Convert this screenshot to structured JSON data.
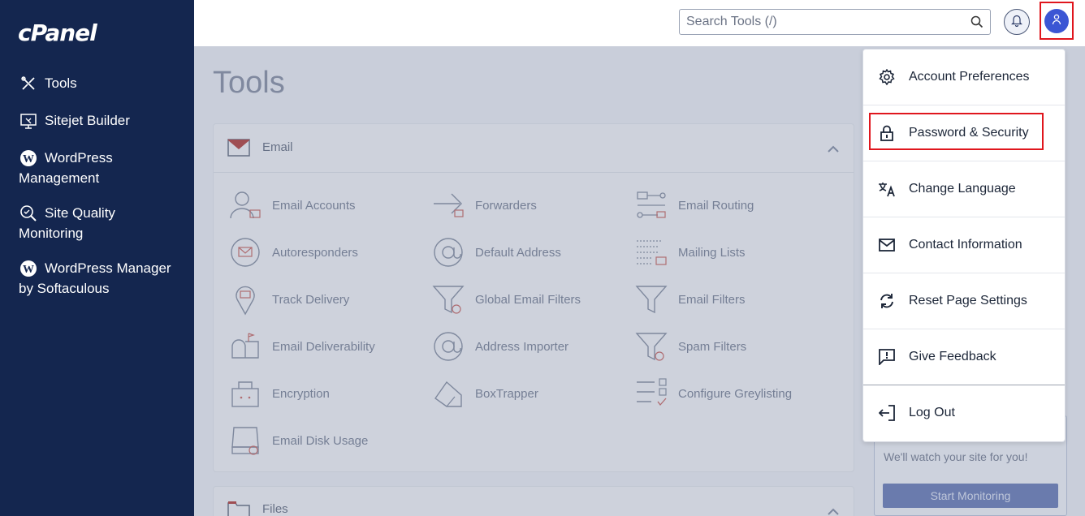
{
  "brand": {
    "logo_text": "cPanel"
  },
  "sidebar": {
    "items": [
      {
        "label": "Tools",
        "icon": "tools-icon"
      },
      {
        "label": "Sitejet Builder",
        "icon": "sitejet-icon"
      },
      {
        "label": "WordPress",
        "label2": "Management",
        "icon": "wordpress-icon"
      },
      {
        "label": "Site Quality",
        "label2": "Monitoring",
        "icon": "site-quality-icon"
      },
      {
        "label": "WordPress Manager",
        "label2": "by Softaculous",
        "icon": "wordpress-icon"
      }
    ]
  },
  "header": {
    "search_placeholder": "Search Tools (/)",
    "bell_icon": "bell-icon",
    "user_icon": "user-icon"
  },
  "main": {
    "title": "Tools",
    "email_section": {
      "title": "Email",
      "tools": [
        {
          "label": "Email Accounts",
          "icon": "email-accounts-icon"
        },
        {
          "label": "Forwarders",
          "icon": "forwarders-icon"
        },
        {
          "label": "Email Routing",
          "icon": "email-routing-icon"
        },
        {
          "label": "Autoresponders",
          "icon": "autoresponders-icon"
        },
        {
          "label": "Default Address",
          "icon": "default-address-icon"
        },
        {
          "label": "Mailing Lists",
          "icon": "mailing-lists-icon"
        },
        {
          "label": "Track Delivery",
          "icon": "track-delivery-icon"
        },
        {
          "label": "Global Email Filters",
          "icon": "global-email-filters-icon"
        },
        {
          "label": "Email Filters",
          "icon": "email-filters-icon"
        },
        {
          "label": "Email Deliverability",
          "icon": "email-deliverability-icon"
        },
        {
          "label": "Address Importer",
          "icon": "address-importer-icon"
        },
        {
          "label": "Spam Filters",
          "icon": "spam-filters-icon"
        },
        {
          "label": "Encryption",
          "icon": "encryption-icon"
        },
        {
          "label": "BoxTrapper",
          "icon": "boxtrapper-icon"
        },
        {
          "label": "Configure Greylisting",
          "icon": "greylisting-icon"
        },
        {
          "label": "Email Disk Usage",
          "icon": "email-disk-usage-icon"
        }
      ]
    },
    "files_section": {
      "title": "Files"
    },
    "monitor_widget": {
      "text": "We'll watch your site for you!",
      "button": "Start Monitoring"
    }
  },
  "user_menu": {
    "items": [
      {
        "label": "Account Preferences",
        "icon": "gear-icon"
      },
      {
        "label": "Password & Security",
        "icon": "lock-icon"
      },
      {
        "label": "Change Language",
        "icon": "translate-icon"
      },
      {
        "label": "Contact Information",
        "icon": "mail-icon"
      },
      {
        "label": "Reset Page Settings",
        "icon": "refresh-icon"
      },
      {
        "label": "Give Feedback",
        "icon": "feedback-icon"
      },
      {
        "label": "Log Out",
        "icon": "logout-icon"
      }
    ]
  },
  "colors": {
    "sidebar_bg": "#14264f",
    "accent": "#3b56d4",
    "highlight": "#e0161d"
  }
}
